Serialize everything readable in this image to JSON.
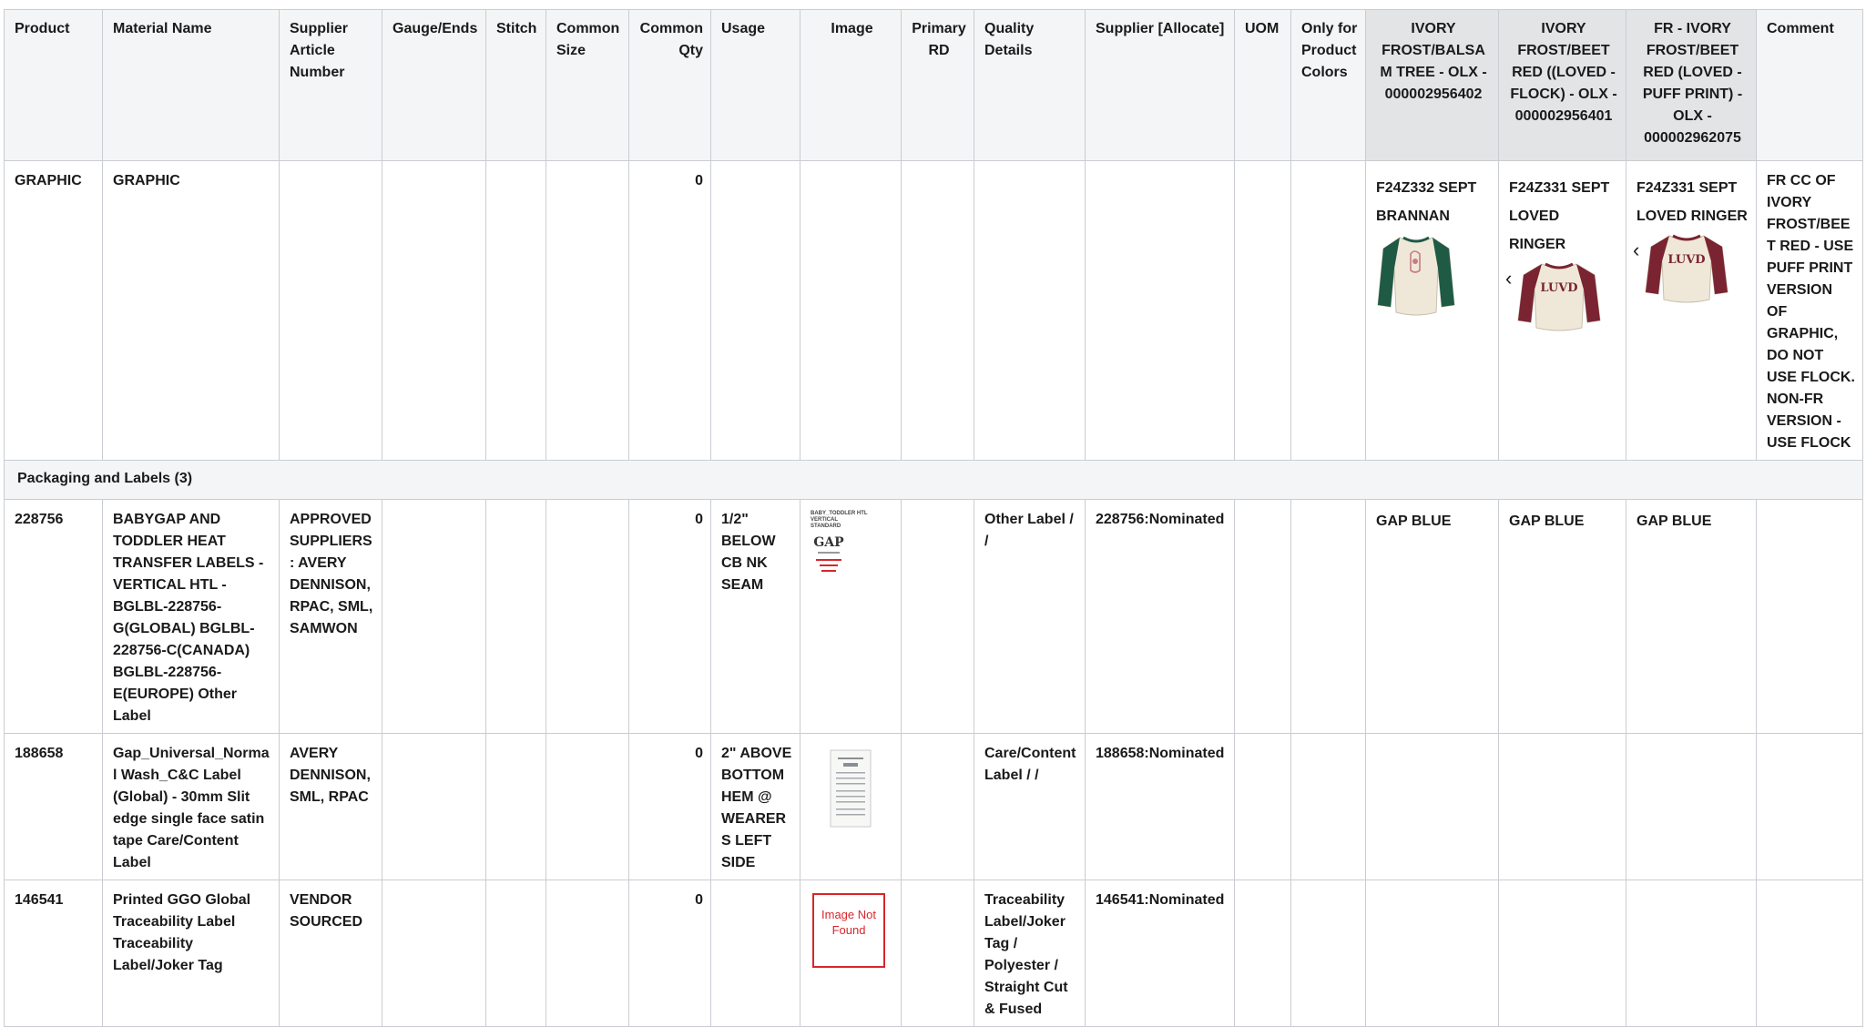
{
  "headers": {
    "product": "Product",
    "material_name": "Material Name",
    "supplier_article_number": "Supplier Article Number",
    "gauge_ends": "Gauge/Ends",
    "stitch": "Stitch",
    "common_size": "Common Size",
    "common_qty": "Common Qty",
    "usage": "Usage",
    "image": "Image",
    "primary_rd": "Primary RD",
    "quality_details": "Quality Details",
    "supplier_allocate": "Supplier [Allocate]",
    "uom": "UOM",
    "only_for_product_colors": "Only for Product Colors",
    "colorway_1": "IVORY FROST/BALSAM TREE - OLX - 000002956402",
    "colorway_2": "IVORY FROST/BEET RED ((LOVED - FLOCK) - OLX - 000002956401",
    "colorway_3": "FR - IVORY FROST/BEET RED (LOVED - PUFF PRINT) - OLX - 000002962075",
    "comment": "Comment"
  },
  "graphic_row": {
    "product": "GRAPHIC",
    "material_name": "GRAPHIC",
    "common_qty": "0",
    "colorway_1": {
      "line1": "F24Z332 SEPT",
      "line2": "BRANNAN"
    },
    "colorway_2": {
      "line1": "F24Z331 SEPT",
      "line2": "LOVED RINGER"
    },
    "colorway_3": {
      "line1": "F24Z331 SEPT",
      "line2": "LOVED RINGER"
    },
    "shirt_text": "LUVD",
    "comment": "FR CC OF IVORY FROST/BEET RED - USE PUFF PRINT VERSION OF GRAPHIC, DO NOT USE FLOCK. NON-FR VERSION - USE FLOCK"
  },
  "section": {
    "label": "Packaging and Labels (3)"
  },
  "rows": [
    {
      "product": "228756",
      "material_name": "BABYGAP AND TODDLER HEAT TRANSFER LABELS - VERTICAL HTL - BGLBL-228756-G(GLOBAL) BGLBL-228756-C(CANADA) BGLBL-228756-E(EUROPE) Other Label",
      "supplier_article_number": "APPROVED SUPPLIERS: AVERY DENNISON, RPAC, SML, SAMWON",
      "common_qty": "0",
      "usage": "1/2\" BELOW CB NK SEAM",
      "image_thumb_title": "BABY_TODDLER HTL VERTICAL STANDARD",
      "image_thumb_brand": "GAP",
      "quality_details": "Other Label / /",
      "supplier_allocate": "228756:Nominated",
      "colorway_1": "GAP BLUE",
      "colorway_2": "GAP BLUE",
      "colorway_3": "GAP BLUE"
    },
    {
      "product": "188658",
      "material_name": "Gap_Universal_Normal Wash_C&C Label (Global) - 30mm Slit edge single face satin tape Care/Content Label",
      "supplier_article_number": "AVERY DENNISON, SML, RPAC",
      "common_qty": "0",
      "usage": "2\" ABOVE BOTTOM HEM @ WEARERS LEFT SIDE",
      "quality_details": "Care/Content Label / /",
      "supplier_allocate": "188658:Nominated"
    },
    {
      "product": "146541",
      "material_name": "Printed GGO Global Traceability Label Traceability Label/Joker Tag",
      "supplier_article_number": "VENDOR SOURCED",
      "common_qty": "0",
      "image_placeholder": "Image Not Found",
      "quality_details": "Traceability Label/Joker Tag / Polyester / Straight Cut & Fused",
      "supplier_allocate": "146541:Nominated"
    }
  ],
  "colors": {
    "header_bg": "#f4f5f6",
    "colorway_header_bg": "#e2e4e6",
    "border": "#c9cdd1",
    "not_found_red": "#d8262b",
    "sleeve_green": "#1f5a45",
    "sleeve_red": "#7a2432",
    "body_ivory": "#efe8d8"
  }
}
